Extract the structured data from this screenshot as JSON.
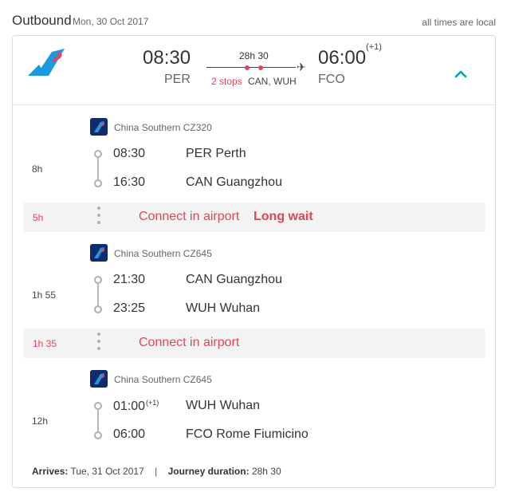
{
  "header": {
    "title": "Outbound",
    "date": "Mon, 30 Oct 2017",
    "times_note": "all times are local"
  },
  "summary": {
    "airline_icon": "china-southern-logo",
    "depart_time": "08:30",
    "depart_code": "PER",
    "duration": "28h 30",
    "stops": "2 stops",
    "stop_codes": "CAN, WUH",
    "arrive_time": "06:00",
    "arrive_day_offset": "(+1)",
    "arrive_code": "FCO",
    "collapse_icon": "chevron-up-icon"
  },
  "legs": [
    {
      "airline": "China Southern CZ320",
      "duration": "8h",
      "dep_time": "08:30",
      "dep_place": "PER Perth",
      "arr_time": "16:30",
      "arr_place": "CAN Guangzhou"
    },
    {
      "airline": "China Southern CZ645",
      "duration": "1h 55",
      "dep_time": "21:30",
      "dep_place": "CAN Guangzhou",
      "arr_time": "23:25",
      "arr_place": "WUH Wuhan"
    },
    {
      "airline": "China Southern CZ645",
      "duration": "12h",
      "dep_time": "01:00",
      "dep_offset": "(+1)",
      "dep_place": "WUH Wuhan",
      "arr_time": "06:00",
      "arr_place": "FCO Rome Fiumicino"
    }
  ],
  "connections": [
    {
      "duration": "5h",
      "text": "Connect in airport",
      "warning": "Long wait"
    },
    {
      "duration": "1h 35",
      "text": "Connect in airport"
    }
  ],
  "footer": {
    "arrives_label": "Arrives:",
    "arrives_value": "Tue, 31 Oct 2017",
    "separator": "|",
    "journey_label": "Journey duration:",
    "journey_value": "28h 30"
  },
  "colors": {
    "accent": "#00a3c4",
    "warning": "#e0455c",
    "airline_blue": "#0d2b6e",
    "airline_sky": "#1a9be0",
    "airline_red": "#e0455c"
  }
}
